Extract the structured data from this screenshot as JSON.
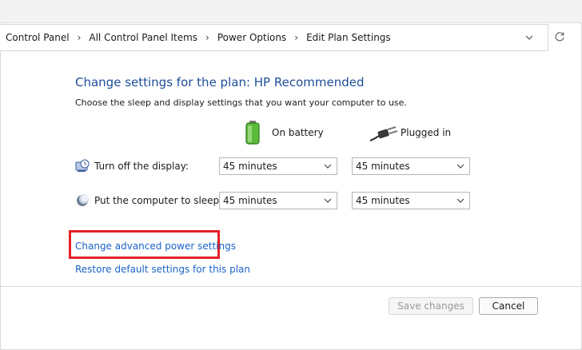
{
  "breadcrumb": {
    "items": [
      "Control Panel",
      "All Control Panel Items",
      "Power Options",
      "Edit Plan Settings"
    ]
  },
  "page": {
    "title": "Change settings for the plan: HP Recommended",
    "subtitle": "Choose the sleep and display settings that you want your computer to use."
  },
  "columns": {
    "battery": "On battery",
    "plugged": "Plugged in"
  },
  "rows": [
    {
      "label": "Turn off the display:",
      "battery": "45 minutes",
      "plugged": "45 minutes"
    },
    {
      "label": "Put the computer to sleep:",
      "battery": "45 minutes",
      "plugged": "45 minutes"
    }
  ],
  "links": {
    "advanced": "Change advanced power settings",
    "restore": "Restore default settings for this plan"
  },
  "buttons": {
    "save": "Save changes",
    "cancel": "Cancel"
  },
  "colors": {
    "title": "#1f4e99",
    "link": "#1b63c6",
    "highlight": "#e32028"
  },
  "icons": [
    "chevron-down-icon",
    "refresh-icon",
    "battery-icon",
    "plug-icon",
    "display-timer-icon",
    "sleep-moon-icon"
  ]
}
